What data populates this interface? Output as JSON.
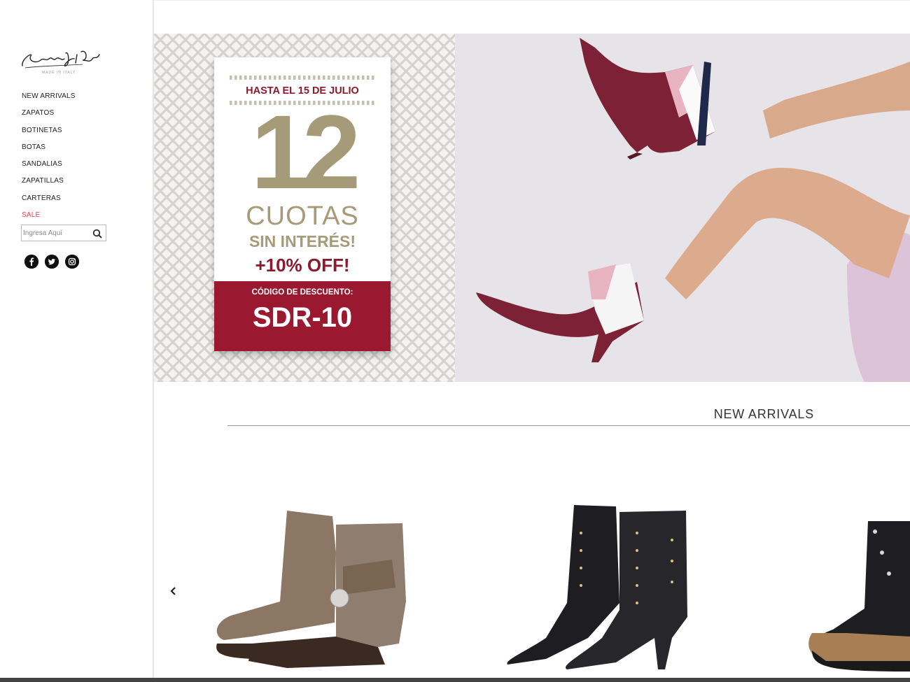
{
  "brand": {
    "logo_text": "Sonnio Di Rossi",
    "tagline": "MADE IN ITALY"
  },
  "nav": {
    "items": [
      "NEW ARRIVALS",
      "ZAPATOS",
      "BOTINETAS",
      "BOTAS",
      "SANDALIAS",
      "ZAPATILLAS",
      "CARTERAS",
      "SALE"
    ]
  },
  "search": {
    "placeholder": "Ingresa Aquí",
    "icon": "search-icon"
  },
  "social": [
    "facebook-icon",
    "twitter-icon",
    "instagram-icon"
  ],
  "banner": {
    "hasta": "HASTA EL 15 DE JULIO",
    "number": "12",
    "cuotas": "CUOTAS",
    "sin_interes": "SIN INTERÉS!",
    "off": "+10% OFF!",
    "code_label": "CÓDIGO DE DESCUENTO:",
    "code": "SDR-10"
  },
  "section": {
    "title": "NEW ARRIVALS",
    "prev_icon": "chevron-left-icon"
  },
  "colors": {
    "accent_wine": "#9a1830",
    "gold": "#a69b78",
    "sale": "#e0455b"
  }
}
